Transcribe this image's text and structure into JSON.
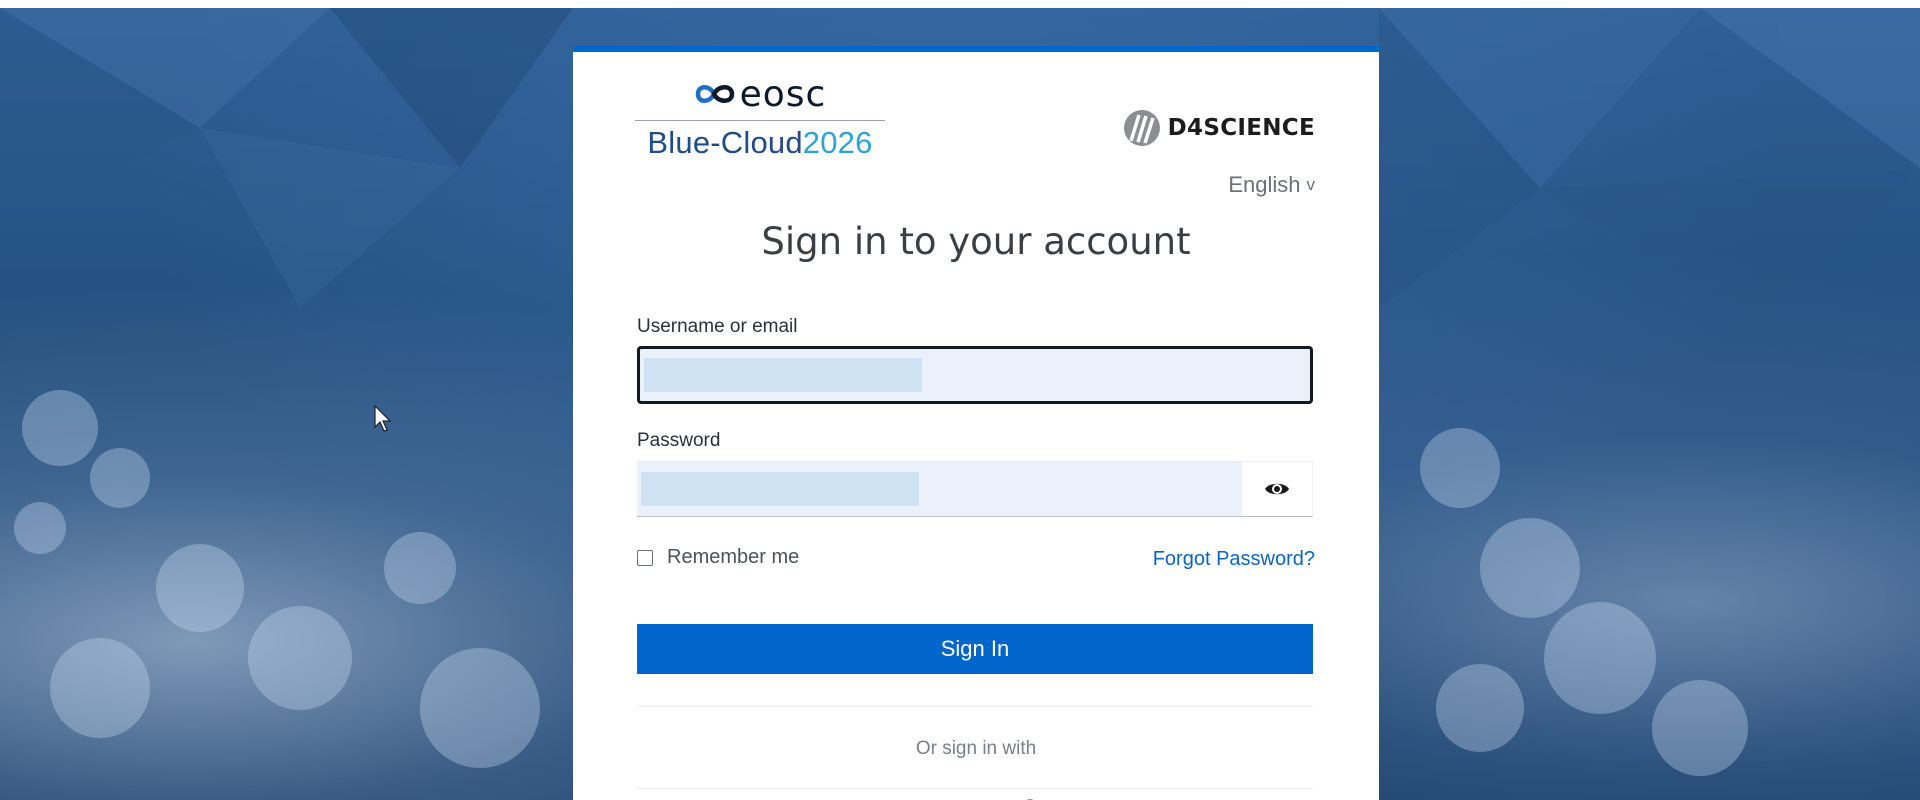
{
  "brand": {
    "eosc_text": "eosc",
    "bluecloud_part1": "Blue-Cloud",
    "bluecloud_part2": "2026",
    "d4science_text": "D4SCIENCE"
  },
  "language": {
    "current": "English",
    "chevron": "v"
  },
  "form": {
    "title": "Sign in to your account",
    "username_label": "Username or email",
    "password_label": "Password",
    "remember_label": "Remember me",
    "forgot_label": "Forgot Password?",
    "submit_label": "Sign In",
    "alt_signin_text": "Or sign in with",
    "show_password_icon": "eye-icon"
  },
  "colors": {
    "accent": "#0066cc",
    "link": "#0b66c2",
    "bluecloud_dark": "#1f4c8c",
    "bluecloud_light": "#2ea3d8",
    "autofill": "#eaf1fb"
  }
}
